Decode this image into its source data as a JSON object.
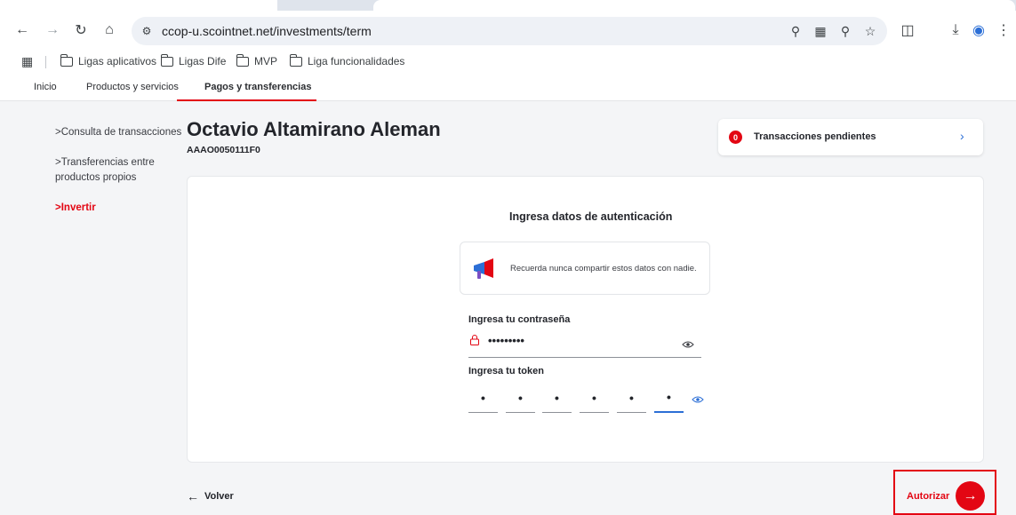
{
  "browser": {
    "url": "ccop-u.scointnet.net/investments/term",
    "bookmarks": [
      "Ligas aplicativos",
      "Ligas Dife",
      "MVP",
      "Liga funcionalidades"
    ]
  },
  "topnav": {
    "items": [
      "Inicio",
      "Productos y servicios",
      "Pagos y transferencias"
    ],
    "active": "Pagos y transferencias"
  },
  "sidebar": {
    "items": [
      {
        "label": "Consulta de transacciones",
        "prefix": ">"
      },
      {
        "label": "Transferencias entre productos propios",
        "prefix": ">"
      },
      {
        "label": "Invertir",
        "prefix": ">"
      }
    ]
  },
  "user": {
    "name": "Octavio Altamirano Aleman",
    "id": "AAAO0050111F0"
  },
  "pending": {
    "count": "0",
    "label": "Transacciones pendientes"
  },
  "auth": {
    "title": "Ingresa datos de autenticación",
    "notice": "Recuerda nunca compartir estos datos con nadie.",
    "password_label": "Ingresa tu contraseña",
    "password_value": "•••••••••",
    "token_label": "Ingresa tu token",
    "token_digits": [
      "•",
      "•",
      "•",
      "•",
      "•",
      "•"
    ]
  },
  "actions": {
    "back": "Volver",
    "authorize": "Autorizar"
  },
  "colors": {
    "brand_red": "#e30613",
    "link_blue": "#2c6fd6"
  }
}
